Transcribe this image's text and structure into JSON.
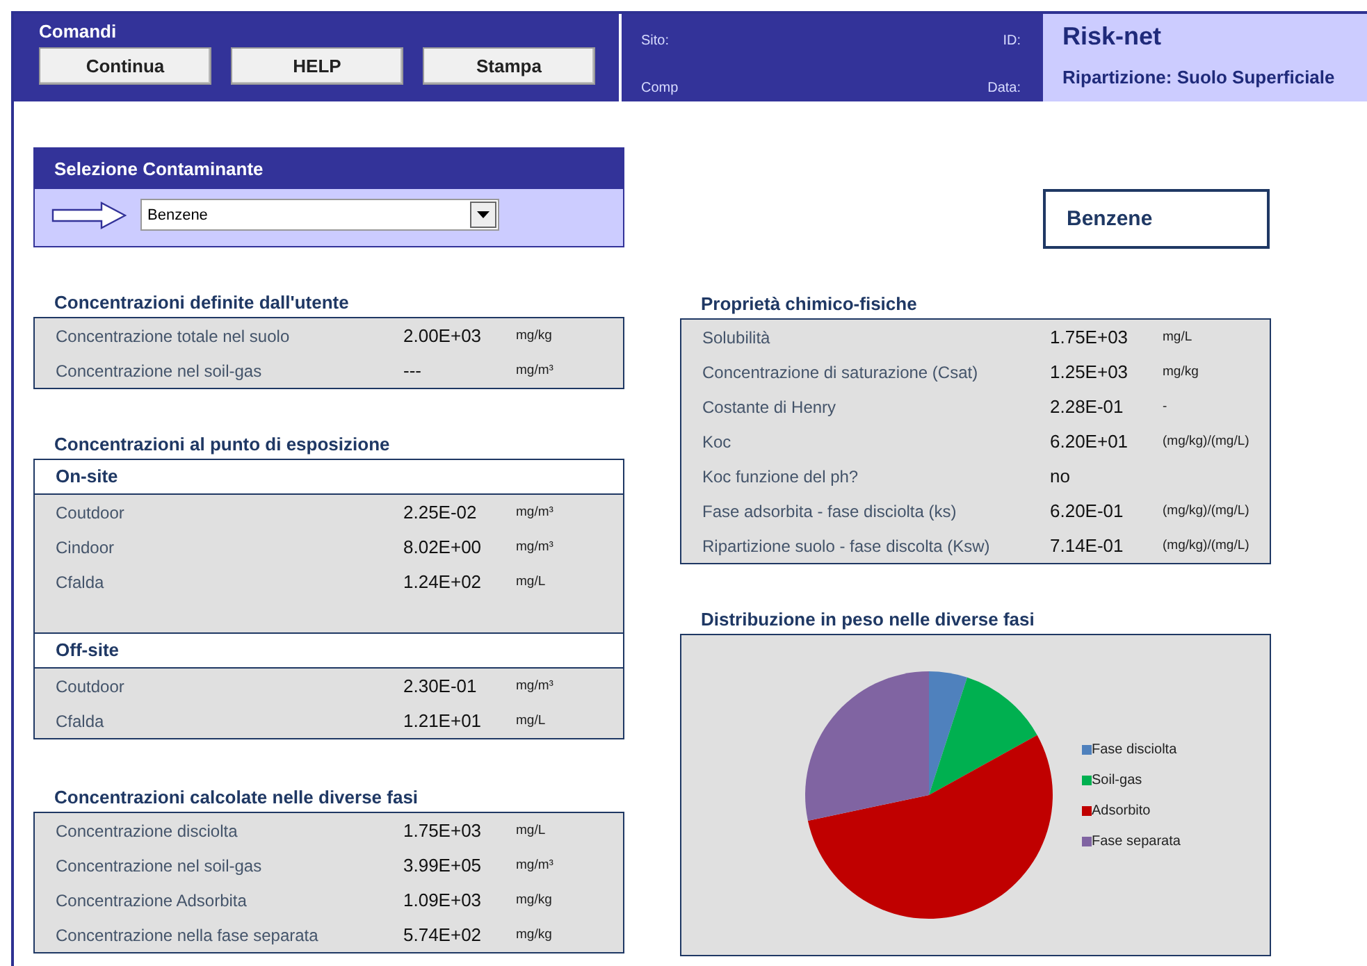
{
  "header": {
    "title": "Comandi",
    "buttons": [
      "Continua",
      "HELP",
      "Stampa"
    ],
    "info_left": [
      "Sito:",
      "Comp"
    ],
    "info_right": [
      "ID:",
      "Data:"
    ],
    "app_name": "Risk-net",
    "subtitle": "Ripartizione: Suolo Superficiale"
  },
  "selection": {
    "title": "Selezione Contaminante",
    "value": "Benzene"
  },
  "selected_name": "Benzene",
  "user_concentrations": {
    "title": "Concentrazioni definite dall'utente",
    "rows": [
      {
        "label": "Concentrazione totale nel suolo",
        "value": "2.00E+03",
        "unit": "mg/kg"
      },
      {
        "label": "Concentrazione nel soil-gas",
        "value": "---",
        "unit": "mg/m³"
      }
    ]
  },
  "exposure": {
    "title": "Concentrazioni al punto di esposizione",
    "groups": [
      {
        "title": "On-site",
        "rows": [
          {
            "label": "Coutdoor",
            "value": "2.25E-02",
            "unit": "mg/m³"
          },
          {
            "label": "Cindoor",
            "value": "8.02E+00",
            "unit": "mg/m³"
          },
          {
            "label": "Cfalda",
            "value": "1.24E+02",
            "unit": "mg/L"
          }
        ]
      },
      {
        "title": "Off-site",
        "rows": [
          {
            "label": "Coutdoor",
            "value": "2.30E-01",
            "unit": "mg/m³"
          },
          {
            "label": "Cfalda",
            "value": "1.21E+01",
            "unit": "mg/L"
          }
        ]
      }
    ]
  },
  "phases": {
    "title": "Concentrazioni calcolate nelle diverse fasi",
    "rows": [
      {
        "label": "Concentrazione disciolta",
        "value": "1.75E+03",
        "unit": "mg/L"
      },
      {
        "label": "Concentrazione nel soil-gas",
        "value": "3.99E+05",
        "unit": "mg/m³"
      },
      {
        "label": "Concentrazione Adsorbita",
        "value": "1.09E+03",
        "unit": "mg/kg"
      },
      {
        "label": "Concentrazione nella fase separata",
        "value": "5.74E+02",
        "unit": "mg/kg"
      }
    ]
  },
  "properties": {
    "title": "Proprietà chimico-fisiche",
    "rows": [
      {
        "label": "Solubilità",
        "value": "1.75E+03",
        "unit": "mg/L"
      },
      {
        "label": "Concentrazione di saturazione (Csat)",
        "value": "1.25E+03",
        "unit": "mg/kg"
      },
      {
        "label": "Costante di Henry",
        "value": "2.28E-01",
        "unit": "-"
      },
      {
        "label": "Koc",
        "value": "6.20E+01",
        "unit": "(mg/kg)/(mg/L)"
      },
      {
        "label": "Koc funzione del ph?",
        "value": "no"
      },
      {
        "label": "Fase adsorbita - fase disciolta (ks)",
        "value": "6.20E-01",
        "unit": "(mg/kg)/(mg/L)"
      },
      {
        "label": "Ripartizione suolo  - fase discolta (Ksw)",
        "value": "7.14E-01",
        "unit": "(mg/kg)/(mg/L)"
      }
    ]
  },
  "distribution": {
    "title": "Distribuzione in peso nelle diverse fasi",
    "legend": [
      {
        "label": "Fase disciolta",
        "color": "#4f81bd"
      },
      {
        "label": "Soil-gas",
        "color": "#00b050"
      },
      {
        "label": "Adsorbito",
        "color": "#c00000"
      },
      {
        "label": "Fase separata",
        "color": "#8064a2"
      }
    ]
  }
}
